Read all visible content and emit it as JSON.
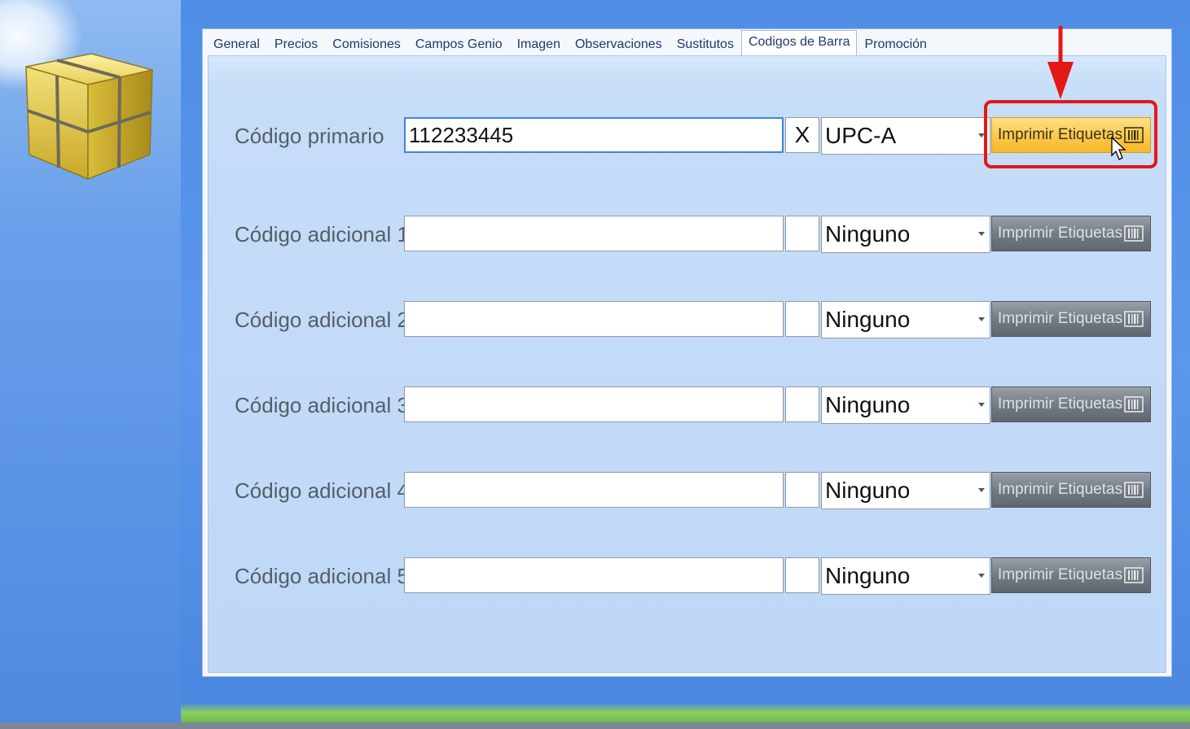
{
  "tabs": [
    {
      "label": "General"
    },
    {
      "label": "Precios"
    },
    {
      "label": "Comisiones"
    },
    {
      "label": "Campos Genio"
    },
    {
      "label": "Imagen"
    },
    {
      "label": "Observaciones"
    },
    {
      "label": "Sustitutos"
    },
    {
      "label": "Codigos de Barra"
    },
    {
      "label": "Promoción"
    }
  ],
  "active_tab": "Codigos de Barra",
  "rows": [
    {
      "label": "Código primario",
      "value": "112233445",
      "checked_mark": "X",
      "format": "UPC-A",
      "button_label": "Imprimir Etiquetas"
    },
    {
      "label": "Código adicional 1",
      "value": "",
      "checked_mark": "",
      "format": "Ninguno",
      "button_label": "Imprimir Etiquetas"
    },
    {
      "label": "Código adicional 2",
      "value": "",
      "checked_mark": "",
      "format": "Ninguno",
      "button_label": "Imprimir Etiquetas"
    },
    {
      "label": "Código adicional 3",
      "value": "",
      "checked_mark": "",
      "format": "Ninguno",
      "button_label": "Imprimir Etiquetas"
    },
    {
      "label": "Código adicional 4",
      "value": "",
      "checked_mark": "",
      "format": "Ninguno",
      "button_label": "Imprimir Etiquetas"
    },
    {
      "label": "Código adicional 5",
      "value": "",
      "checked_mark": "",
      "format": "Ninguno",
      "button_label": "Imprimir Etiquetas"
    }
  ],
  "colors": {
    "highlight": "#e31818",
    "button_hover": "#fccb4a",
    "button_normal": "#767c84",
    "panel_bg": "#c6ddf8"
  },
  "icons": {
    "app_logo": "yellow-cube-icon",
    "print_button": "barcode-icon",
    "annotation": "red-arrow-icon",
    "pointer": "mouse-cursor-icon"
  }
}
